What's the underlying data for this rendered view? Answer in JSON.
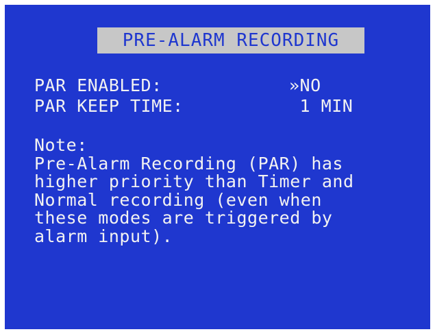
{
  "screen": {
    "title": "PRE-ALARM RECORDING",
    "background_color": "#1f37cf",
    "title_bar_color": "#c7c7c7",
    "text_color": "#f2f2f2"
  },
  "settings": [
    {
      "label": "PAR ENABLED:",
      "value": "»NO"
    },
    {
      "label": "PAR KEEP TIME:",
      "value": " 1 MIN"
    }
  ],
  "note": {
    "heading": "Note:",
    "lines": [
      "Pre-Alarm Recording (PAR) has",
      "higher priority than Timer and",
      "Normal recording (even when",
      "these modes are triggered by",
      "alarm input)."
    ]
  }
}
